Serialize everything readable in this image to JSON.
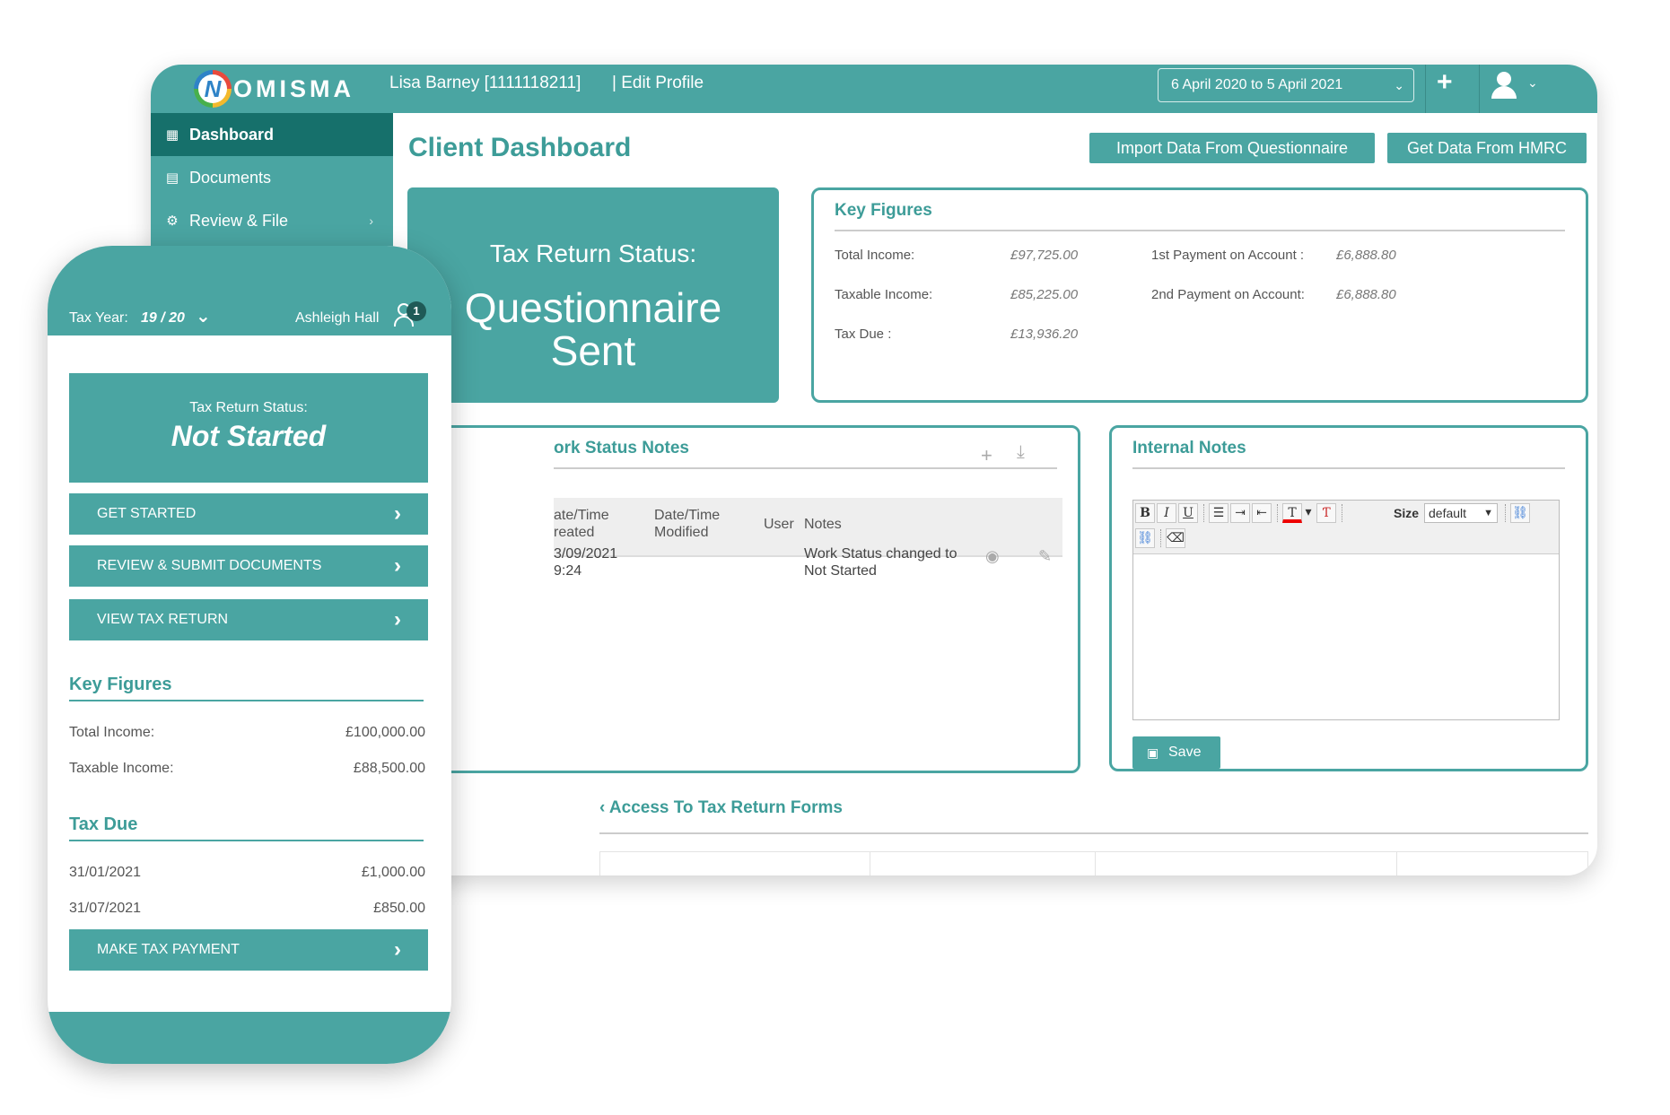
{
  "desktop": {
    "logo_text": "OMISMA",
    "logo_letter": "N",
    "client_name": "Lisa Barney [1111118211]",
    "edit_profile": "| Edit Profile",
    "period": "6 April 2020 to 5 April 2021",
    "sidebar": {
      "items": [
        {
          "label": "Dashboard",
          "icon": "grid-icon",
          "active": true
        },
        {
          "label": "Documents",
          "icon": "documents-icon",
          "active": false
        },
        {
          "label": "Review & File",
          "icon": "review-icon",
          "active": false
        }
      ]
    },
    "page_title": "Client Dashboard",
    "buttons": {
      "import": "Import Data From Questionnaire",
      "hmrc": "Get Data From HMRC"
    },
    "status_tile": {
      "label": "Tax Return Status:",
      "value": "Questionnaire Sent"
    },
    "key_figures": {
      "title": "Key Figures",
      "rows": [
        {
          "label": "Total Income:",
          "value": "£97,725.00"
        },
        {
          "label": "Taxable Income:",
          "value": "£85,225.00"
        },
        {
          "label": "Tax Due :",
          "value": "£13,936.20"
        }
      ],
      "payments": [
        {
          "label": "1st Payment on Account :",
          "value": "£6,888.80"
        },
        {
          "label": "2nd Payment on Account:",
          "value": "£6,888.80"
        }
      ]
    },
    "work_status": {
      "title": "ork Status Notes",
      "headers": {
        "created_1": "ate/Time",
        "created_2": "reated",
        "modified_1": "Date/Time",
        "modified_2": "Modified",
        "user": "User",
        "notes": "Notes"
      },
      "row": {
        "created_1": "3/09/2021",
        "created_2": "9:24",
        "note_1": "Work Status changed to",
        "note_2": "Not Started"
      }
    },
    "internal_notes": {
      "title": "Internal Notes",
      "toolbar": {
        "bold": "B",
        "italic": "I",
        "underline": "U",
        "size_label": "Size",
        "size_value": "default"
      },
      "save": "Save"
    },
    "quick_access_title": "‹ Access To Tax Return Forms"
  },
  "phone": {
    "tax_year_label": "Tax Year:",
    "tax_year_value": "19 / 20",
    "user_name": "Ashleigh Hall",
    "badge": "1",
    "status_label": "Tax Return Status:",
    "status_value": "Not Started",
    "buttons": [
      "GET STARTED",
      "REVIEW & SUBMIT DOCUMENTS",
      "VIEW TAX RETURN"
    ],
    "key_figures": {
      "title": "Key Figures",
      "rows": [
        {
          "label": "Total Income:",
          "value": "£100,000.00"
        },
        {
          "label": "Taxable Income:",
          "value": "£88,500.00"
        }
      ]
    },
    "tax_due": {
      "title": "Tax Due",
      "rows": [
        {
          "label": "31/01/2021",
          "value": "£1,000.00"
        },
        {
          "label": "31/07/2021",
          "value": "£850.00"
        }
      ]
    },
    "pay_button": "MAKE TAX PAYMENT"
  },
  "colors": {
    "teal": "#4aa5a2",
    "teal_dark": "#16706b",
    "teal_text": "#3d9c98"
  }
}
